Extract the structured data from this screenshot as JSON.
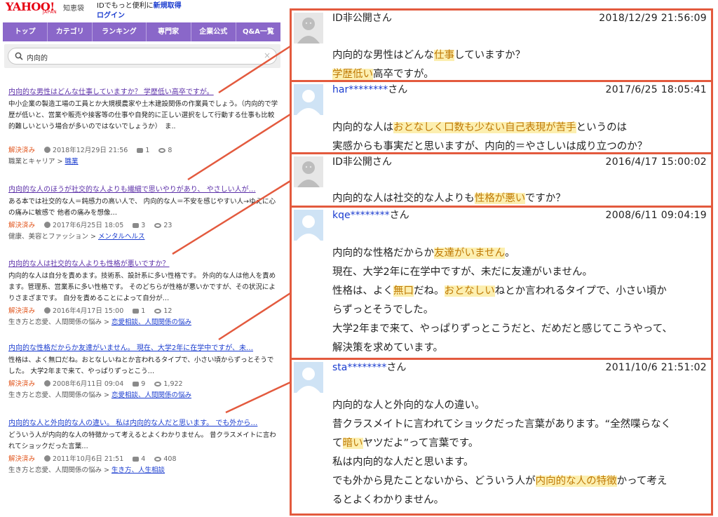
{
  "header": {
    "logo_text": "YAHOO!",
    "logo_sub": "JAPAN",
    "service": "知恵袋",
    "id_prompt": "IDでもっと便利に",
    "register_link": "新規取得",
    "login_link": "ログイン"
  },
  "nav": {
    "tabs": [
      "トップ",
      "カテゴリ",
      "ランキング",
      "専門家",
      "企業公式",
      "Q&A一覧"
    ]
  },
  "search": {
    "query": "内向的",
    "clear_icon": "×"
  },
  "results": [
    {
      "title": "内向的な男性はどんな仕事していますか？ 学歴低い高卒ですが。",
      "snippet": "中小企業の製造工場の工員とか大規模農家や土木建設関係の作業員でしょう。（内向的で学歴が低いと、営業や販売や接客等の仕事や自発的に正しい選択をして行動する仕事も比較的難しいという場合が多いのではないでしょうか）　ま..",
      "status": "解決済み",
      "date": "2018年12月29日 21:56",
      "answers": "1",
      "views": "8",
      "category_path": "職業とキャリア",
      "category_link": "職業"
    },
    {
      "title": "内向的な人のほうが社交的な人よりも繊細で思いやりがあり、 やさしい人が…",
      "snippet": "ある本では社交的な人＝鈍感力の高い人で、 内向的な人＝不安を感じやすい人→ゆえに心の痛みに敏感で 他者の痛みを想像…",
      "status": "解決済み",
      "date": "2017年6月25日 18:05",
      "answers": "3",
      "views": "23",
      "category_path": "健康、美容とファッション",
      "category_link": "メンタルヘルス"
    },
    {
      "title": "内向的な人は社交的な人よりも性格が悪いですか？",
      "snippet": "内向的な人は自分を責めます。技術系、設計系に多い性格です。 外向的な人は他人を責めます。管理系、営業系に多い性格です。 そのどちらが性格が悪いかですが、その状況によりさまざまです。 自分を責めることによって自分が…",
      "status": "解決済み",
      "date": "2016年4月17日 15:00",
      "answers": "1",
      "views": "12",
      "category_path": "生き方と恋愛、人間関係の悩み",
      "category_link": "恋愛相談、人間関係の悩み"
    },
    {
      "title": "内向的な性格だからか友達がいません。 現在、大学2年に在学中ですが、未…",
      "snippet": "性格は、よく無口だね。おとなしいねとか言われるタイプで、小さい頃からずっとそうでした。 大学2年まで来て、やっぱりずっとこう…",
      "status": "解決済み",
      "date": "2008年6月11日 09:04",
      "answers": "9",
      "views": "1,922",
      "category_path": "生き方と恋愛、人間関係の悩み",
      "category_link": "恋愛相談、人間関係の悩み"
    },
    {
      "title": "内向的な人と外向的な人の違い。 私は内向的な人だと思います。 でも外から…",
      "snippet": "どういう人が内向的な人の特徴かって考えるとよくわかりません。 昔クラスメイトに言われてショックだった言葉…",
      "status": "解決済み",
      "date": "2011年10月6日 21:51",
      "answers": "4",
      "views": "408",
      "category_path": "生き方と恋愛、人間関係の悩み",
      "category_link": "生き方、人生相談"
    }
  ],
  "panels": [
    {
      "user_prefix": "ID非公開",
      "user_suffix": "さん",
      "avatar": "anonymous-avatar",
      "timestamp": "2018/12/29  21:56:09",
      "lines": [
        [
          [
            "内向的な男性はどんな",
            ""
          ],
          [
            "仕事",
            "hl"
          ],
          [
            "していますか？",
            ""
          ]
        ],
        [
          [
            "学歴低い",
            "hl"
          ],
          [
            "高卒ですが。",
            ""
          ]
        ]
      ]
    },
    {
      "user_prefix": "har********",
      "user_suffix": "さん",
      "avatar": "user-avatar",
      "timestamp": "2017/6/25  18:05:41",
      "lines": [
        [
          [
            "内向的な人は",
            ""
          ],
          [
            "おとなしく口数も少ない自己表現が苦手",
            "hl"
          ],
          [
            "というのは",
            ""
          ]
        ],
        [
          [
            "実感からも事実だと思いますが、内向的＝やさしいは成り立つのか？",
            ""
          ]
        ]
      ]
    },
    {
      "user_prefix": "ID非公開",
      "user_suffix": "さん",
      "avatar": "anonymous-avatar",
      "timestamp": "2016/4/17  15:00:02",
      "lines": [
        [
          [
            "内向的な人は社交的な人よりも",
            ""
          ],
          [
            "性格が悪い",
            "hl"
          ],
          [
            "ですか？",
            ""
          ]
        ]
      ]
    },
    {
      "user_prefix": "kqe********",
      "user_suffix": "さん",
      "avatar": "user-avatar",
      "timestamp": "2008/6/11  09:04:19",
      "lines": [
        [
          [
            "内向的な性格だからか",
            ""
          ],
          [
            "友達がいません",
            "hl"
          ],
          [
            "。",
            ""
          ]
        ],
        [
          [
            "現在、大学2年に在学中ですが、未だに友達がいません。",
            ""
          ]
        ],
        [
          [
            "性格は、よく",
            ""
          ],
          [
            "無口",
            "hl"
          ],
          [
            "だね。",
            ""
          ],
          [
            "おとなしい",
            "hl"
          ],
          [
            "ねとか言われるタイプで、小さい頃か",
            ""
          ]
        ],
        [
          [
            "らずっとそうでした。",
            ""
          ]
        ],
        [
          [
            "大学2年まで来て、やっぱりずっとこうだと、だめだと感じてこうやって、",
            ""
          ]
        ],
        [
          [
            "解決策を求めています。",
            ""
          ]
        ]
      ]
    },
    {
      "user_prefix": "sta********",
      "user_suffix": "さん",
      "avatar": "user-avatar",
      "timestamp": "2011/10/6  21:51:02",
      "lines": [
        [
          [
            "内向的な人と外向的な人の違い。",
            ""
          ]
        ],
        [
          [
            "昔クラスメイトに言われてショックだった言葉があります。“全然喋らなく",
            ""
          ]
        ],
        [
          [
            "て",
            ""
          ],
          [
            "暗い",
            "hl"
          ],
          [
            "ヤツだよ”って言葉です。",
            ""
          ]
        ],
        [
          [
            "私は内向的な人だと思います。",
            ""
          ]
        ],
        [
          [
            "でも外から見たことないから、どういう人が",
            ""
          ],
          [
            "内向的な人の特徴",
            "hl"
          ],
          [
            "かって考え",
            ""
          ]
        ],
        [
          [
            "るとよくわかりません。",
            ""
          ]
        ]
      ]
    }
  ],
  "colors": {
    "nav_purple": "#8a67c9",
    "frame_red": "#e35a3e",
    "highlight": "#fcefb0",
    "link_blue": "#1a3ccf",
    "visited_purple": "#5b2fa8",
    "solved_orange": "#e2571f"
  }
}
